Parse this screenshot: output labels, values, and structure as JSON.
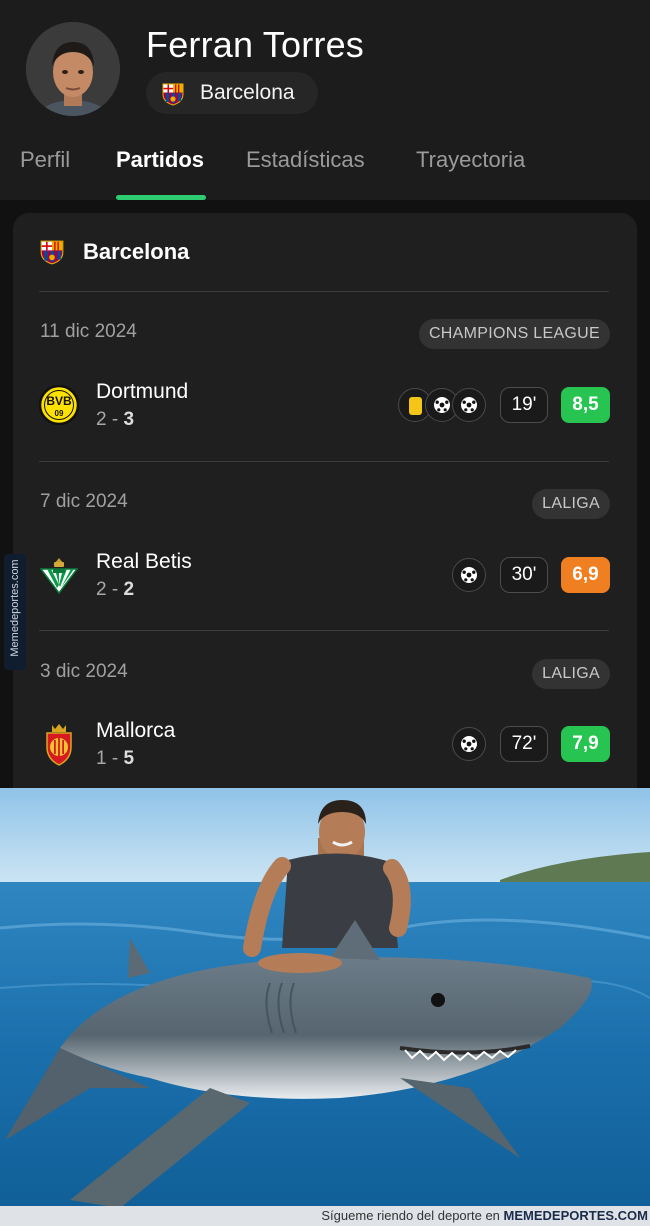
{
  "player": {
    "name": "Ferran Torres",
    "club": "Barcelona"
  },
  "tabs": [
    {
      "label": "Perfil",
      "active": false
    },
    {
      "label": "Partidos",
      "active": true
    },
    {
      "label": "Estadísticas",
      "active": false
    },
    {
      "label": "Trayectoria",
      "active": false
    }
  ],
  "card": {
    "team": "Barcelona",
    "matches": [
      {
        "date": "11 dic 2024",
        "competition": "CHAMPIONS LEAGUE",
        "opponent": "Dortmund",
        "score_a": "2",
        "score_sep": " - ",
        "score_b": "3",
        "events": [
          "yellow-card",
          "goal",
          "goal"
        ],
        "minutes": "19'",
        "rating": "8,5",
        "rating_color": "#27c451"
      },
      {
        "date": "7 dic 2024",
        "competition": "LALIGA",
        "opponent": "Real Betis",
        "score_a": "2",
        "score_sep": " - ",
        "score_b": "2",
        "events": [
          "goal"
        ],
        "minutes": "30'",
        "rating": "6,9",
        "rating_color": "#f07f22"
      },
      {
        "date": "3 dic 2024",
        "competition": "LALIGA",
        "opponent": "Mallorca",
        "score_a": "1",
        "score_sep": " - ",
        "score_b": "5",
        "events": [
          "goal"
        ],
        "minutes": "72'",
        "rating": "7,9",
        "rating_color": "#27c451"
      }
    ]
  },
  "watermark": {
    "side": "Memedeportes.com",
    "footer_prefix": "Sígueme riendo del deporte en",
    "footer_brand": "MEMEDEPORTES.COM"
  },
  "colors": {
    "accent": "#2ecc71",
    "background": "#1c1c1c",
    "card": "#1f1f1f"
  }
}
